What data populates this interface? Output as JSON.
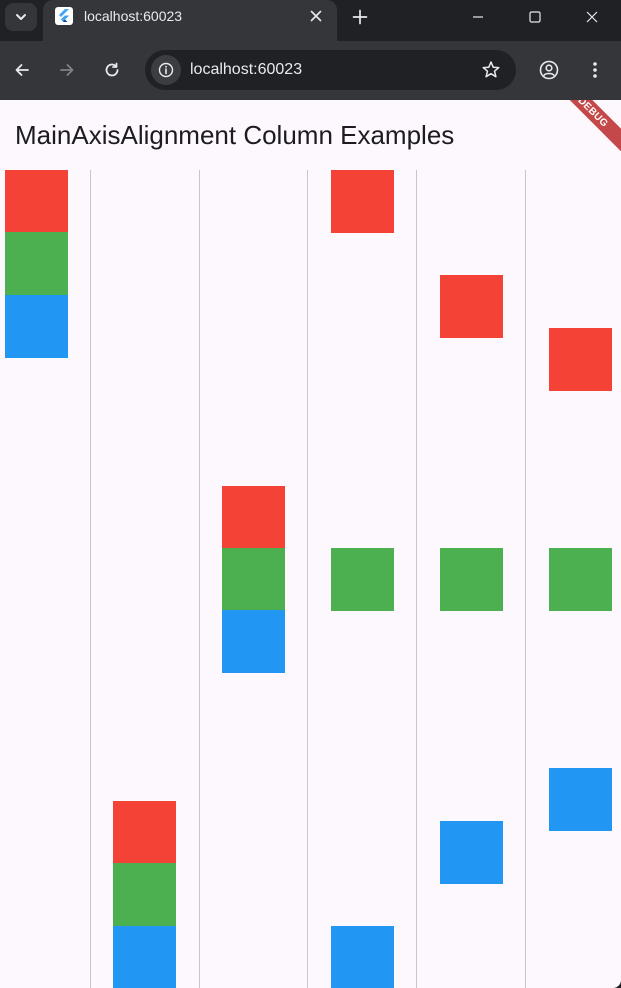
{
  "browser": {
    "tab": {
      "title": "localhost:60023"
    },
    "omnibox": {
      "url": "localhost:60023"
    }
  },
  "app": {
    "title": "MainAxisAlignment Column Examples",
    "debug_banner": "DEBUG"
  },
  "colors": {
    "red": "#f44336",
    "green": "#4caf50",
    "blue": "#2196f3",
    "background": "#fdf7fe",
    "divider": "#cac4d0"
  },
  "columns": [
    {
      "main_axis_alignment": "start",
      "boxes": [
        "red",
        "green",
        "blue"
      ]
    },
    {
      "main_axis_alignment": "end",
      "boxes": [
        "red",
        "green",
        "blue"
      ]
    },
    {
      "main_axis_alignment": "center",
      "boxes": [
        "red",
        "green",
        "blue"
      ]
    },
    {
      "main_axis_alignment": "spaceBetween",
      "boxes": [
        "red",
        "green",
        "blue"
      ]
    },
    {
      "main_axis_alignment": "spaceAround",
      "boxes": [
        "red",
        "green",
        "blue"
      ]
    },
    {
      "main_axis_alignment": "spaceEvenly",
      "boxes": [
        "red",
        "green",
        "blue"
      ]
    }
  ]
}
